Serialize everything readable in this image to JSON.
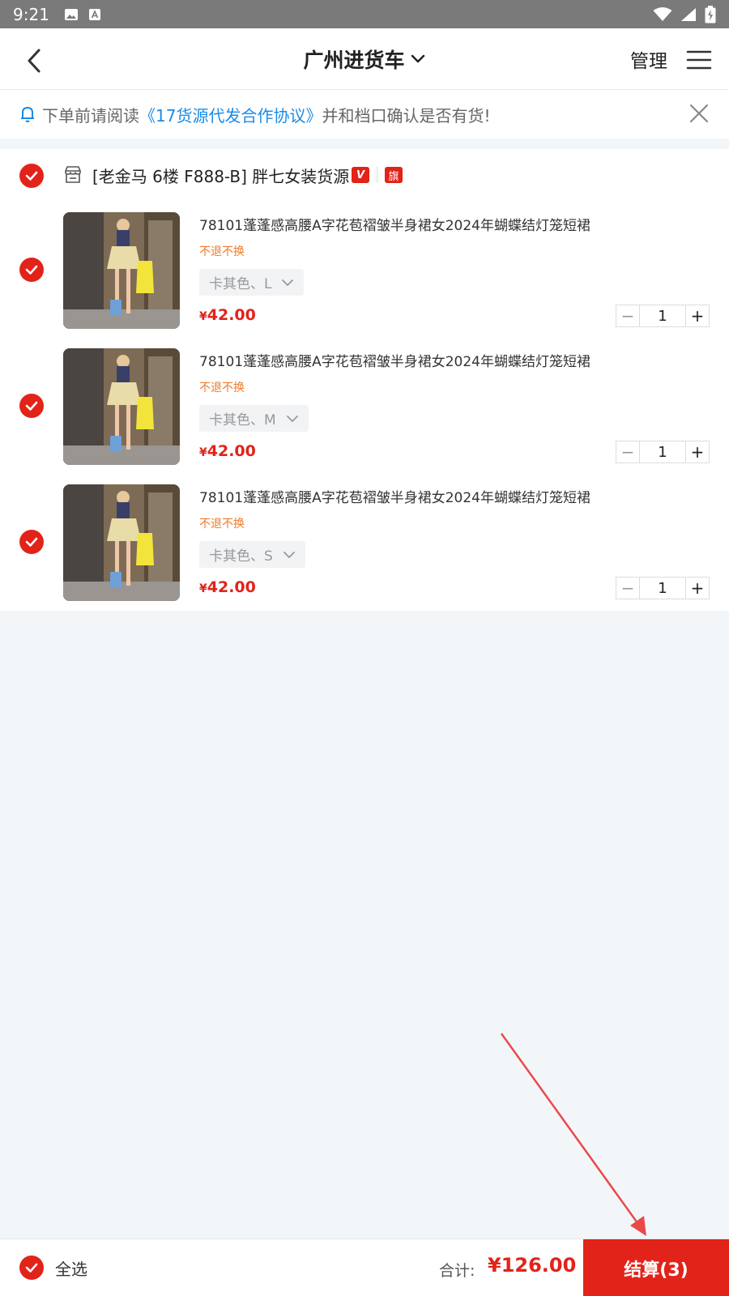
{
  "status_bar": {
    "time": "9:21"
  },
  "nav": {
    "title": "广州进货车",
    "manage_label": "管理"
  },
  "notice": {
    "prefix": "下单前请阅读",
    "link": "《17货源代发合作协议》",
    "suffix": "并和档口确认是否有货!"
  },
  "store": {
    "name": "[老金马 6楼 F888-B] 胖七女装货源",
    "badge_v": "V",
    "badge_flag": "旗"
  },
  "items": [
    {
      "title": "78101蓬蓬感高腰A字花苞褶皱半身裙女2024年蝴蝶结灯笼短裙",
      "tag": "不退不换",
      "spec": "卡其色、L",
      "currency": "¥",
      "price": "42.00",
      "quantity": "1"
    },
    {
      "title": "78101蓬蓬感高腰A字花苞褶皱半身裙女2024年蝴蝶结灯笼短裙",
      "tag": "不退不换",
      "spec": "卡其色、M",
      "currency": "¥",
      "price": "42.00",
      "quantity": "1"
    },
    {
      "title": "78101蓬蓬感高腰A字花苞褶皱半身裙女2024年蝴蝶结灯笼短裙",
      "tag": "不退不换",
      "spec": "卡其色、S",
      "currency": "¥",
      "price": "42.00",
      "quantity": "1"
    }
  ],
  "bottom": {
    "select_all_label": "全选",
    "total_label": "合计:",
    "total_value": "¥126.00",
    "checkout_label": "结算(3)"
  },
  "colors": {
    "accent": "#e2231a",
    "link": "#1a8be6",
    "tag": "#f07a2a"
  }
}
